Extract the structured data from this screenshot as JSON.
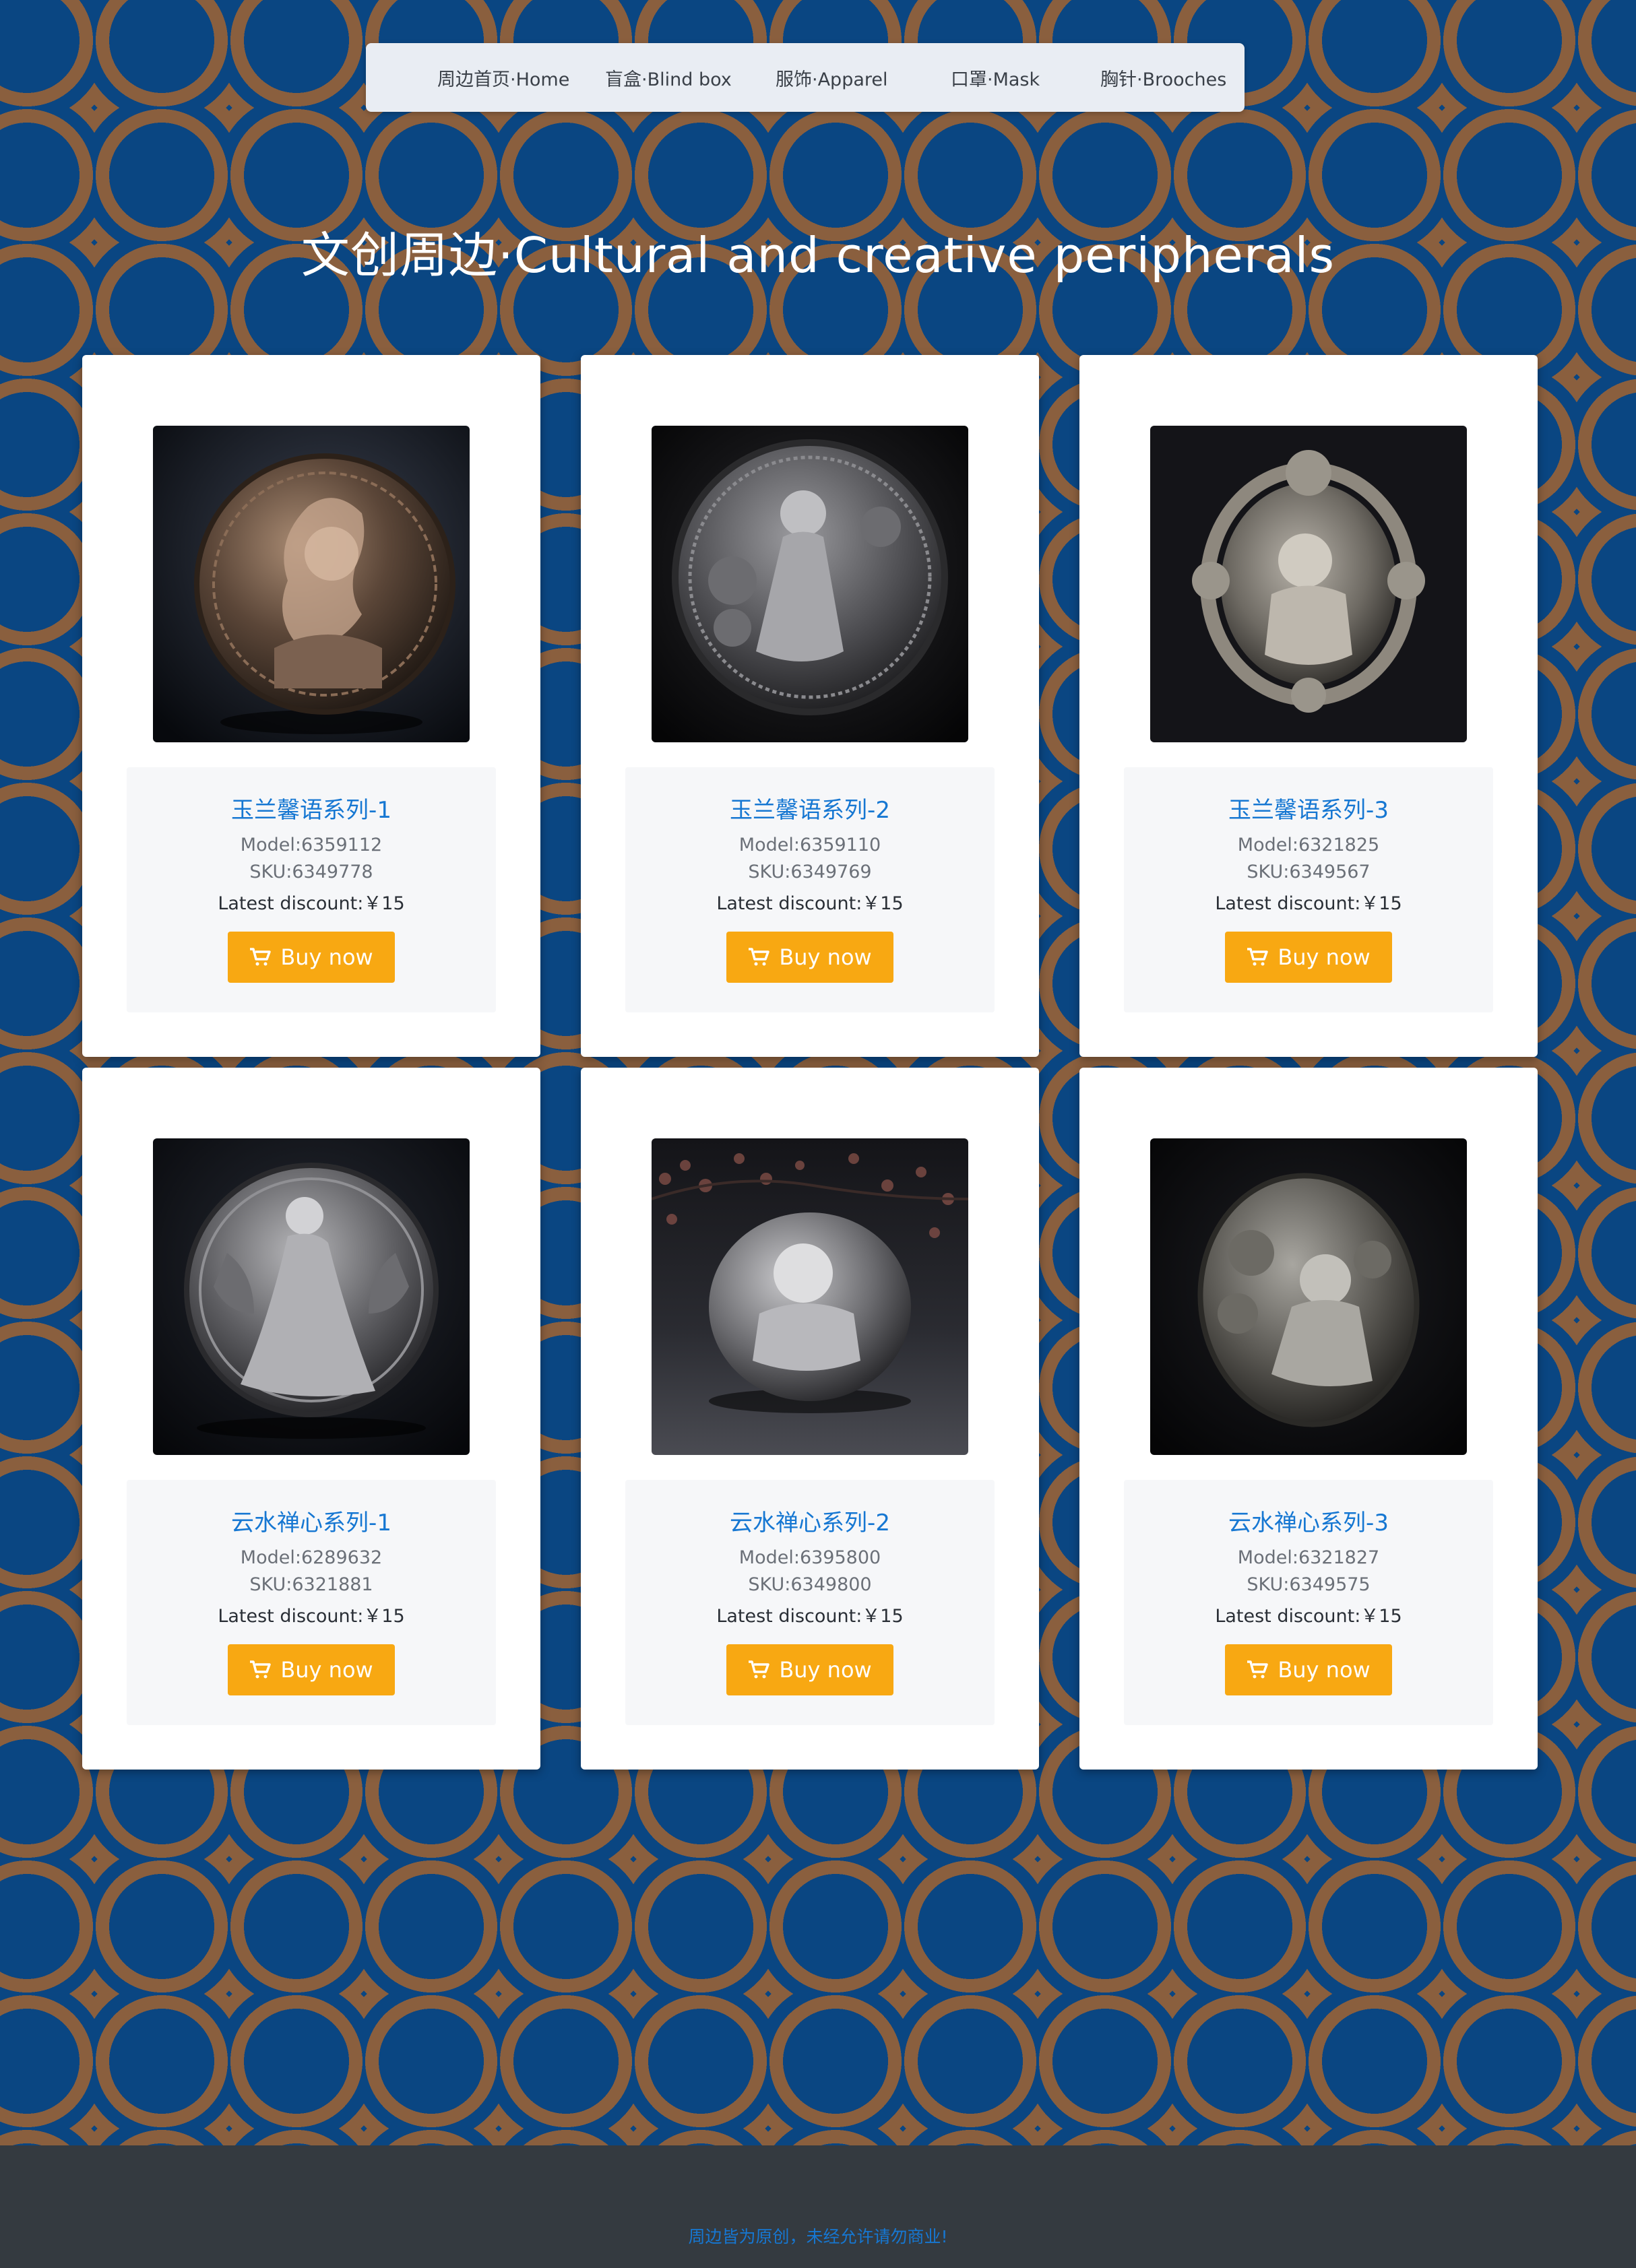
{
  "nav": {
    "items": [
      {
        "label": "周边首页·Home"
      },
      {
        "label": "盲盒·Blind box"
      },
      {
        "label": "服饰·Apparel"
      },
      {
        "label": "口罩·Mask"
      },
      {
        "label": "胸针·Brooches"
      }
    ]
  },
  "hero": {
    "title": "文创周边·Cultural and creative peripherals"
  },
  "products": [
    {
      "title": "玉兰馨语系列-1",
      "model": "Model:6359112",
      "sku": "SKU:6349778",
      "discount": "Latest discount:￥15",
      "button": "Buy now",
      "image": "medallion-lady-profile"
    },
    {
      "title": "玉兰馨语系列-2",
      "model": "Model:6359110",
      "sku": "SKU:6349769",
      "discount": "Latest discount:￥15",
      "button": "Buy now",
      "image": "medallion-seated-lady"
    },
    {
      "title": "玉兰馨语系列-3",
      "model": "Model:6321825",
      "sku": "SKU:6349567",
      "discount": "Latest discount:￥15",
      "button": "Buy now",
      "image": "brooch-lady-ornate-frame"
    },
    {
      "title": "云水禅心系列-1",
      "model": "Model:6289632",
      "sku": "SKU:6321881",
      "discount": "Latest discount:￥15",
      "button": "Buy now",
      "image": "medallion-dancing-lady"
    },
    {
      "title": "云水禅心系列-2",
      "model": "Model:6395800",
      "sku": "SKU:6349800",
      "discount": "Latest discount:￥15",
      "button": "Buy now",
      "image": "pebble-lady-with-blossoms"
    },
    {
      "title": "云水禅心系列-3",
      "model": "Model:6321827",
      "sku": "SKU:6349575",
      "discount": "Latest discount:￥15",
      "button": "Buy now",
      "image": "medallion-lady-flowers"
    }
  ],
  "footer": {
    "note": "周边皆为原创，未经允许请勿商业!"
  },
  "colors": {
    "background": "#0a4682",
    "ring_pattern": "#8a5f3e",
    "accent_link": "#1677d2",
    "buy_button": "#f8a812",
    "footer": "#343a40"
  }
}
